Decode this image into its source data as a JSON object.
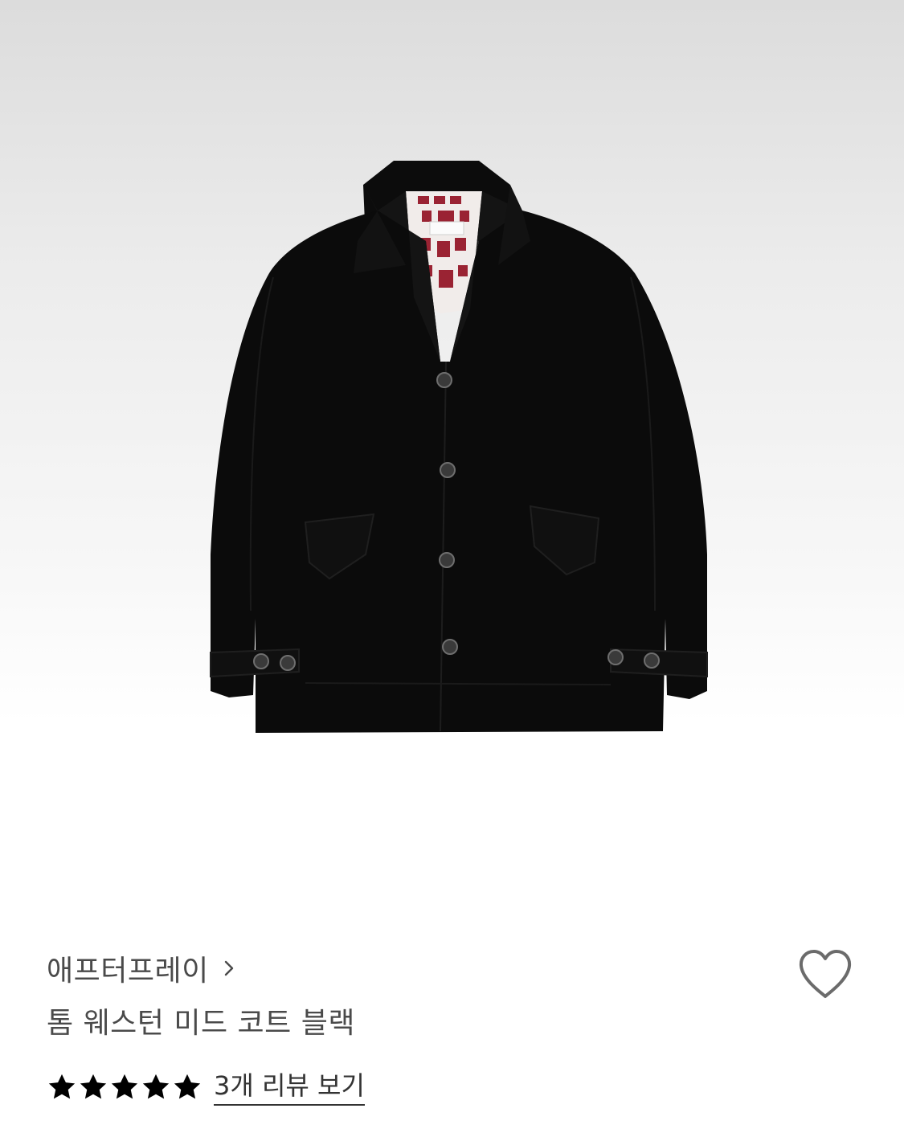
{
  "product_image": {
    "alt": "",
    "icon": "product-photo"
  },
  "brand": {
    "name": "애프터프레이",
    "chevron_icon": "chevron-right-icon"
  },
  "product": {
    "name": "톰 웨스턴 미드 코트 블랙"
  },
  "rating": {
    "stars": 5,
    "max_stars": 5,
    "reviews_label": "3개 리뷰 보기",
    "star_color": "#000000"
  },
  "wishlist": {
    "icon": "heart-outline-icon",
    "color": "#6b6b6b"
  }
}
